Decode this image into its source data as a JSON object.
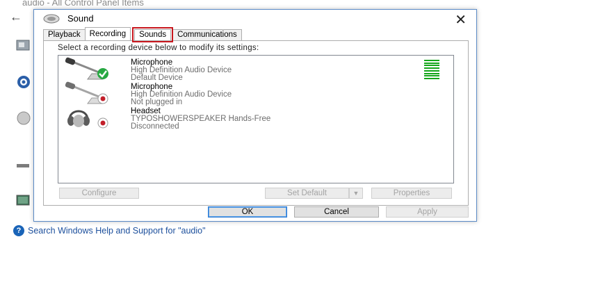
{
  "background": {
    "window_title": "audio - All Control Panel Items",
    "help_link": "Search Windows Help and Support for \"audio\""
  },
  "dialog": {
    "title": "Sound",
    "tabs": [
      {
        "label": "Playback"
      },
      {
        "label": "Recording"
      },
      {
        "label": "Sounds"
      },
      {
        "label": "Communications"
      }
    ],
    "active_tab": "Recording",
    "highlighted_tab": "Sounds",
    "instruction": "Select a recording device below to modify its settings:",
    "devices": [
      {
        "name": "Microphone",
        "line2": "High Definition Audio Device",
        "line3": "Default Device",
        "status": "default",
        "icon": "microphone-icon"
      },
      {
        "name": "Microphone",
        "line2": "High Definition Audio Device",
        "line3": "Not plugged in",
        "status": "unplugged",
        "icon": "microphone-icon"
      },
      {
        "name": "Headset",
        "line2": "TYPOSHOWERSPEAKER Hands-Free",
        "line3": "Disconnected",
        "status": "disconnected",
        "icon": "headset-icon"
      }
    ],
    "buttons": {
      "configure": "Configure",
      "set_default": "Set Default",
      "properties": "Properties",
      "ok": "OK",
      "cancel": "Cancel",
      "apply": "Apply"
    }
  },
  "colors": {
    "highlight": "#c8161d",
    "meter_green": "#14a61a",
    "check_green": "#27a842",
    "status_red": "#c21f2a",
    "link_blue": "#1c4f9c"
  }
}
